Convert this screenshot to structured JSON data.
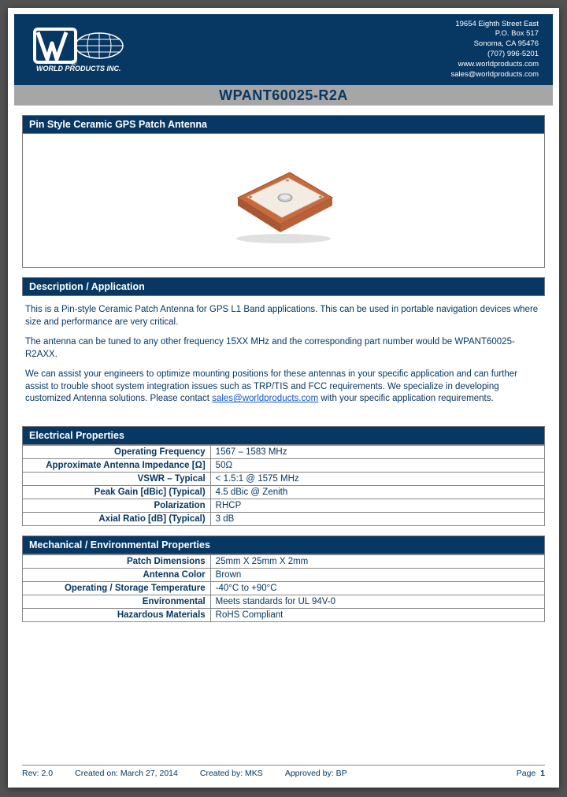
{
  "header": {
    "company_name": "WORLD PRODUCTS INC.",
    "address": [
      "19654 Eighth Street East",
      "P.O. Box 517",
      "Sonoma, CA 95476",
      "(707) 996-5201",
      "www.worldproducts.com",
      "sales@worldproducts.com"
    ]
  },
  "part_number": "WPANT60025-R2A",
  "sections": {
    "product_title": "Pin Style Ceramic GPS Patch Antenna",
    "description_title": "Description / Application",
    "description_p1": "This is a Pin-style Ceramic Patch Antenna for GPS L1 Band applications. This can be used in portable navigation devices where size and performance are very critical.",
    "description_p2": "The antenna can be tuned to any other frequency 15XX MHz and the corresponding part number would be WPANT60025-R2AXX.",
    "description_p3a": "We can assist your engineers to optimize mounting positions for these antennas in your specific application and can further assist to trouble shoot system integration issues such as TRP/TIS and FCC requirements. We specialize in developing customized Antenna solutions. Please contact ",
    "description_email": "sales@worldproducts.com",
    "description_p3b": " with your specific application requirements.",
    "electrical_title": "Electrical Properties",
    "mechanical_title": "Mechanical / Environmental Properties"
  },
  "electrical": [
    {
      "label": "Operating Frequency",
      "value": "1567 – 1583 MHz"
    },
    {
      "label": "Approximate Antenna Impedance [Ω]",
      "value": "50Ω"
    },
    {
      "label": "VSWR – Typical",
      "value": "< 1.5:1 @ 1575 MHz"
    },
    {
      "label": "Peak Gain [dBic] (Typical)",
      "value": "4.5 dBic @ Zenith"
    },
    {
      "label": "Polarization",
      "value": "RHCP"
    },
    {
      "label": "Axial Ratio [dB] (Typical)",
      "value": "3 dB"
    }
  ],
  "mechanical": [
    {
      "label": "Patch Dimensions",
      "value": "25mm  X  25mm  X  2mm"
    },
    {
      "label": "Antenna Color",
      "value": "Brown"
    },
    {
      "label": "Operating / Storage Temperature",
      "value": "-40°C to +90°C"
    },
    {
      "label": "Environmental",
      "value": "Meets standards for UL 94V-0"
    },
    {
      "label": "Hazardous Materials",
      "value": "RoHS Compliant"
    }
  ],
  "footer": {
    "rev": "Rev: 2.0",
    "created_on": "Created on: March 27, 2014",
    "created_by": "Created by: MKS",
    "approved_by": "Approved by: BP",
    "page_label": "Page",
    "page_num": "1"
  }
}
